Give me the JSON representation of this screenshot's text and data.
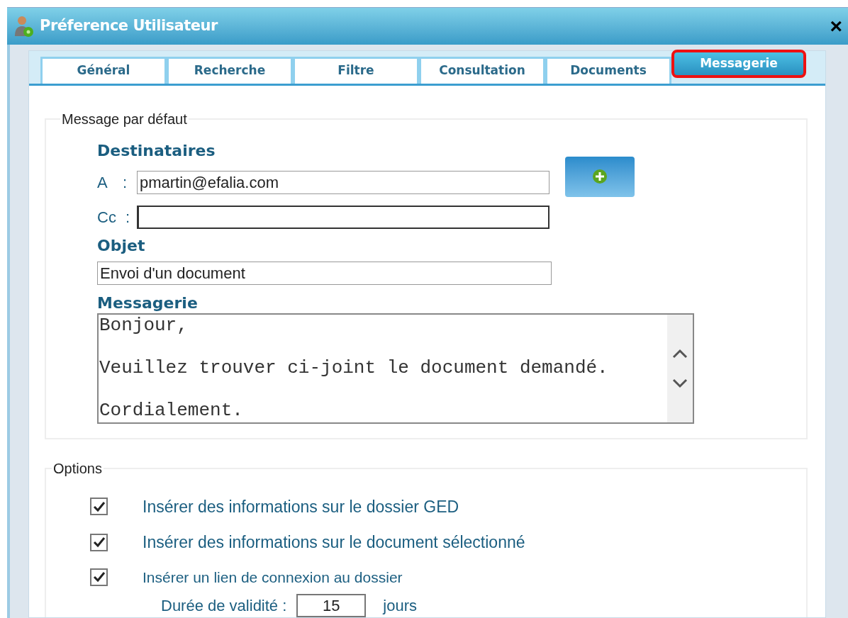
{
  "window": {
    "title": "Préference Utilisateur",
    "close": "×"
  },
  "tabs": [
    {
      "label": "Général",
      "selected": false
    },
    {
      "label": "Recherche",
      "selected": false
    },
    {
      "label": "Filtre",
      "selected": false
    },
    {
      "label": "Consultation",
      "selected": false
    },
    {
      "label": "Documents",
      "selected": false
    },
    {
      "label": "Messagerie",
      "selected": true
    }
  ],
  "default_message": {
    "legend": "Message par défaut",
    "recipients_heading": "Destinataires",
    "to_label": "A",
    "to_colon": ":",
    "to_value": "pmartin@efalia.com",
    "cc_label": "Cc",
    "cc_colon": ":",
    "subject_heading": "Objet",
    "subject_value": "Envoi d'un document",
    "message_heading": "Messagerie",
    "message_paragraphs": [
      "Bonjour,",
      "Veuillez trouver ci-joint le document demandé.",
      "Cordialement."
    ]
  },
  "options": {
    "legend": "Options",
    "items": [
      {
        "label": "Insérer des informations sur le dossier GED",
        "checked": true
      },
      {
        "label": "Insérer des informations sur le document sélectionné",
        "checked": true
      },
      {
        "label": "Insérer un lien de connexion au dossier",
        "checked": true
      }
    ],
    "validity_label": "Durée de validité :",
    "validity_value": "15",
    "validity_unit": "jours"
  }
}
